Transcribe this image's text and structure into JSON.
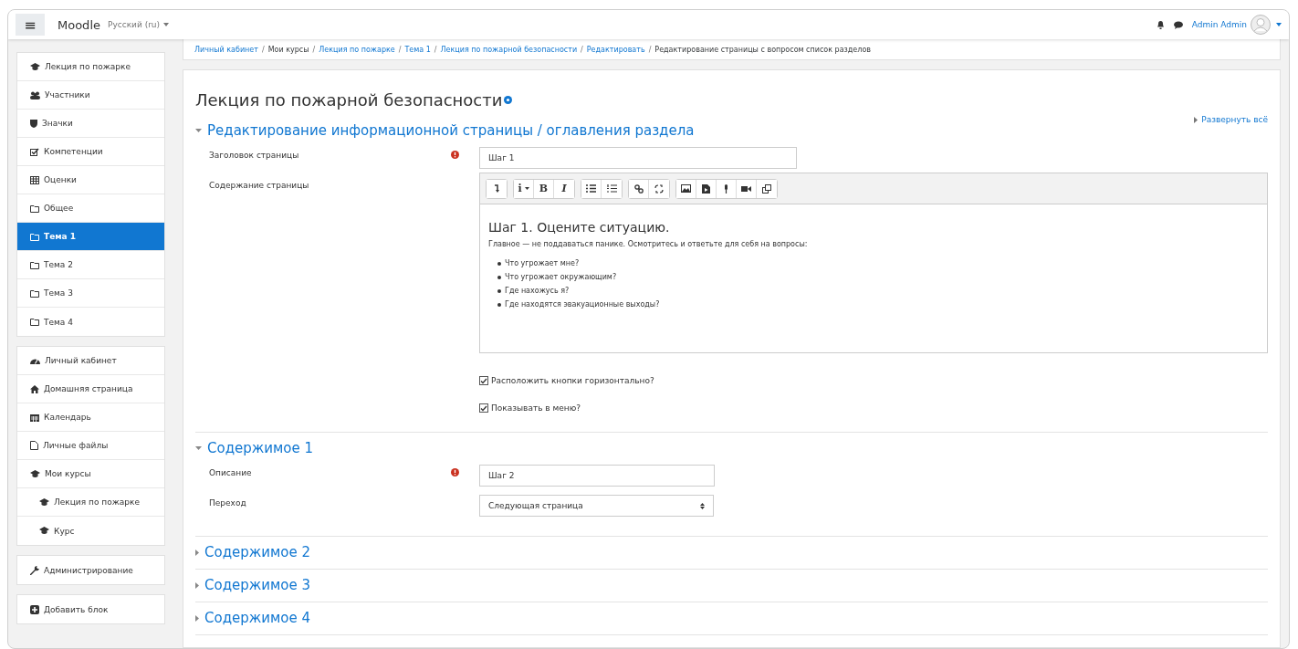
{
  "navbar": {
    "menu_glyph": "≡",
    "brand": "Moodle",
    "language": "Русский (ru)",
    "user": "Admin Admin"
  },
  "breadcrumb": {
    "separator": "/",
    "items": [
      {
        "label": "Личный кабинет",
        "link": true
      },
      {
        "label": "Мои курсы",
        "link": false
      },
      {
        "label": "Лекция по пожарке",
        "link": true
      },
      {
        "label": "Тема 1",
        "link": true
      },
      {
        "label": "Лекция по пожарной безопасности",
        "link": true
      },
      {
        "label": "Редактировать",
        "link": true
      },
      {
        "label": "Редактирование страницы с вопросом список разделов",
        "link": false
      }
    ]
  },
  "sidebar": {
    "blocks": [
      {
        "items": [
          {
            "label": "Лекция по пожарке",
            "selected": false
          },
          {
            "label": "Участники",
            "selected": false
          },
          {
            "label": "Значки",
            "selected": false
          },
          {
            "label": "Компетенции",
            "selected": false
          },
          {
            "label": "Оценки",
            "selected": false
          },
          {
            "label": "Общее",
            "selected": false
          },
          {
            "label": "Тема 1",
            "selected": true
          },
          {
            "label": "Тема 2",
            "selected": false
          },
          {
            "label": "Тема 3",
            "selected": false
          },
          {
            "label": "Тема 4",
            "selected": false
          }
        ]
      },
      {
        "items": [
          {
            "label": "Личный кабинет",
            "selected": false
          },
          {
            "label": "Домашняя страница",
            "selected": false
          },
          {
            "label": "Календарь",
            "selected": false
          },
          {
            "label": "Личные файлы",
            "selected": false
          },
          {
            "label": "Мои курсы",
            "selected": false,
            "children": [
              {
                "label": "Лекция по пожарке",
                "selected": false
              },
              {
                "label": "Курс",
                "selected": false
              }
            ]
          }
        ]
      },
      {
        "items": [
          {
            "label": "Администрирование",
            "selected": false
          }
        ]
      },
      {
        "items": [
          {
            "label": "Добавить блок",
            "selected": false
          }
        ]
      }
    ]
  },
  "page_title": "Лекция по пожарной безопасности",
  "expand_all": "Развернуть всё",
  "sections": [
    {
      "title": "Редактирование информационной страницы / оглавления раздела",
      "expanded": true,
      "fields": [
        {
          "kind": "text",
          "label": "Заголовок страницы",
          "required": true,
          "value": "Шаг 1"
        },
        {
          "kind": "editor",
          "label": "Содержание страницы",
          "toolbar_text": [
            "i",
            "B",
            "I"
          ],
          "heading": "Шаг 1. Оцените ситуацию.",
          "paragraph": "Главное — не поддаваться панике. Осмотритесь и ответьте для себя на вопросы:",
          "bullets": [
            "Что угрожает мне?",
            "Что угрожает окружающим?",
            "Где нахожусь я?",
            "Где находятся эвакуационные выходы?"
          ]
        },
        {
          "kind": "checkbox",
          "label": "Расположить кнопки горизонтально?",
          "checked": true
        },
        {
          "kind": "checkbox",
          "label": "Показывать в меню?",
          "checked": true
        }
      ]
    },
    {
      "title": "Содержимое 1",
      "expanded": true,
      "fields": [
        {
          "kind": "text",
          "label": "Описание",
          "required": true,
          "value": "Шаг 2"
        },
        {
          "kind": "select",
          "label": "Переход",
          "value": "Следующая страница"
        }
      ]
    },
    {
      "title": "Содержимое 2",
      "expanded": false
    },
    {
      "title": "Содержимое 3",
      "expanded": false
    },
    {
      "title": "Содержимое 4",
      "expanded": false
    }
  ]
}
